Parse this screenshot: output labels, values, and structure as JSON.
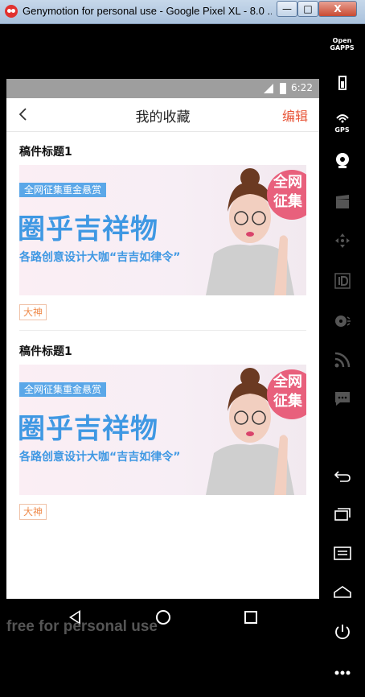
{
  "window": {
    "title": "Genymotion for personal use - Google Pixel XL - 8.0 ...",
    "min_label": "—",
    "max_label": "□",
    "close_label": "X"
  },
  "statusbar": {
    "time": "6:22"
  },
  "appbar": {
    "title": "我的收藏",
    "edit_label": "编辑"
  },
  "cards": [
    {
      "title": "稿件标题1",
      "banner": {
        "tagline": "全网征集重金悬赏",
        "headline": "圈乎吉祥物",
        "subline": "各路创意设计大咖“吉吉如律令”",
        "bubble": "全网 征集"
      },
      "tag": "大神"
    },
    {
      "title": "稿件标题1",
      "banner": {
        "tagline": "全网征集重金悬赏",
        "headline": "圈乎吉祥物",
        "subline": "各路创意设计大咖“吉吉如律令”",
        "bubble": "全网 征集"
      },
      "tag": "大神"
    }
  ],
  "watermark": "free for personal use",
  "sidebar": {
    "open_gapps_label": "Open\nGAPPS",
    "gps_label": "GPS",
    "icons": [
      "open-gapps-icon",
      "battery-icon",
      "gps-icon",
      "webcam-icon",
      "video-icon",
      "dpad-icon",
      "id-icon",
      "sound-icon",
      "rss-icon",
      "chat-icon",
      "back-icon",
      "recents-icon",
      "menu-icon",
      "home-icon",
      "power-icon",
      "more-icon"
    ]
  },
  "colors": {
    "accent": "#e8573a",
    "tag": "#ef8a4a",
    "banner_blue": "#3f98e3",
    "status_gray": "#9e9e9e"
  }
}
